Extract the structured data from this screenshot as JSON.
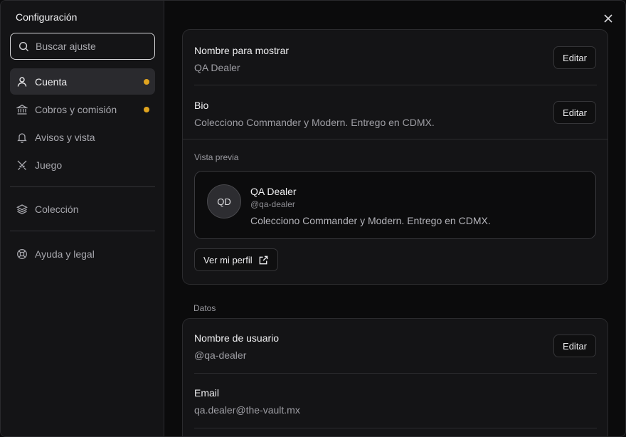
{
  "sidebar": {
    "title": "Configuración",
    "search_placeholder": "Buscar ajuste",
    "items": [
      {
        "label": "Cuenta",
        "icon": "user-icon",
        "active": true,
        "dot": true
      },
      {
        "label": "Cobros y comisión",
        "icon": "bank-icon",
        "active": false,
        "dot": true
      },
      {
        "label": "Avisos y vista",
        "icon": "bell-icon",
        "active": false,
        "dot": false
      },
      {
        "label": "Juego",
        "icon": "crossed-swords-icon",
        "active": false,
        "dot": false
      },
      {
        "label": "Colección",
        "icon": "layers-icon",
        "active": false,
        "dot": false
      },
      {
        "label": "Ayuda y legal",
        "icon": "lifebuoy-icon",
        "active": false,
        "dot": false
      }
    ]
  },
  "profile": {
    "display_name_label": "Nombre para mostrar",
    "display_name_value": "QA Dealer",
    "bio_label": "Bio",
    "bio_value": "Colecciono Commander y Modern. Entrego en CDMX.",
    "edit_label": "Editar",
    "preview_label": "Vista previa",
    "preview": {
      "initials": "QD",
      "name": "QA Dealer",
      "handle": "@qa-dealer",
      "bio": "Colecciono Commander y Modern. Entrego en CDMX."
    },
    "view_profile_label": "Ver mi perfil"
  },
  "data_section": {
    "title": "Datos",
    "username_label": "Nombre de usuario",
    "username_value": "@qa-dealer",
    "email_label": "Email",
    "email_value": "qa.dealer@the-vault.mx"
  },
  "colors": {
    "accent_dot": "#e0a41f",
    "background": "#0b0b0c",
    "sidebar": "#141416"
  }
}
